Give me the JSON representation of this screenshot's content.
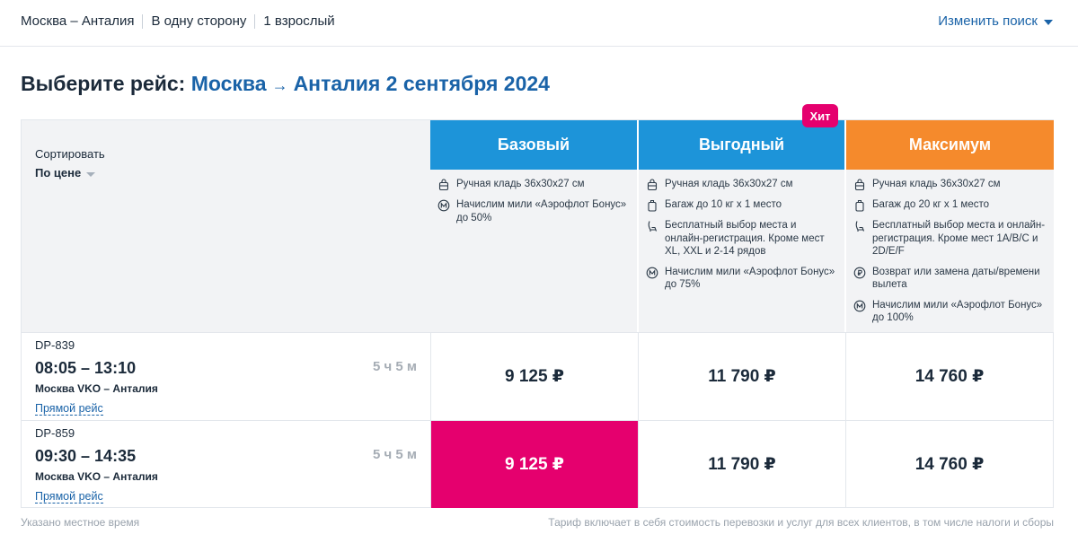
{
  "search_bar": {
    "route": "Москва – Анталия",
    "trip_type": "В одну сторону",
    "passengers": "1 взрослый",
    "change_search_label": "Изменить поиск"
  },
  "heading": {
    "prefix": "Выберите рейс:",
    "origin": "Москва",
    "arrow": "→",
    "destination_date": "Анталия 2 сентября 2024"
  },
  "sort": {
    "label": "Сортировать",
    "value": "По цене"
  },
  "badge": {
    "hit": "Хит"
  },
  "tariffs": [
    {
      "name": "Базовый",
      "color": "#1d94d9",
      "features": [
        {
          "icon": "hand-luggage-icon",
          "text": "Ручная кладь 36х30х27 см"
        },
        {
          "icon": "miles-icon",
          "text": "Начислим мили «Аэрофлот Бонус» до 50%"
        }
      ]
    },
    {
      "name": "Выгодный",
      "color": "#1d94d9",
      "features": [
        {
          "icon": "hand-luggage-icon",
          "text": "Ручная кладь 36х30х27 см"
        },
        {
          "icon": "baggage-icon",
          "text": "Багаж до 10 кг х 1 место"
        },
        {
          "icon": "seat-icon",
          "text": "Бесплатный выбор места и онлайн-регистрация. Кроме мест XL, XXL и 2-14 рядов"
        },
        {
          "icon": "miles-icon",
          "text": "Начислим мили «Аэрофлот Бонус» до 75%"
        }
      ]
    },
    {
      "name": "Максимум",
      "color": "#f58a2c",
      "features": [
        {
          "icon": "hand-luggage-icon",
          "text": "Ручная кладь 36х30х27 см"
        },
        {
          "icon": "baggage-icon",
          "text": "Багаж до 20 кг х 1 место"
        },
        {
          "icon": "seat-icon",
          "text": "Бесплатный выбор места и онлайн-регистрация. Кроме мест 1A/B/C и 2D/E/F"
        },
        {
          "icon": "refund-icon",
          "text": "Возврат или замена даты/времени вылета"
        },
        {
          "icon": "miles-icon",
          "text": "Начислим мили «Аэрофлот Бонус» до 100%"
        }
      ]
    }
  ],
  "flights": [
    {
      "number": "DP-839",
      "times": "08:05 – 13:10",
      "route": "Москва VKO – Анталия",
      "type": "Прямой рейс",
      "duration": "5 ч 5 м",
      "prices": [
        "9 125 ₽",
        "11 790 ₽",
        "14 760 ₽"
      ],
      "selected_index": -1
    },
    {
      "number": "DP-859",
      "times": "09:30 – 14:35",
      "route": "Москва VKO – Анталия",
      "type": "Прямой рейс",
      "duration": "5 ч 5 м",
      "prices": [
        "9 125 ₽",
        "11 790 ₽",
        "14 760 ₽"
      ],
      "selected_index": 0
    }
  ],
  "footer": {
    "left": "Указано местное время",
    "right": "Тариф включает в себя стоимость перевозки и услуг для всех клиентов, в том числе налоги и сборы"
  },
  "colors": {
    "brand_blue": "#1a63a8",
    "tariff_blue": "#1d94d9",
    "tariff_orange": "#f58a2c",
    "accent_pink": "#e5006e"
  }
}
